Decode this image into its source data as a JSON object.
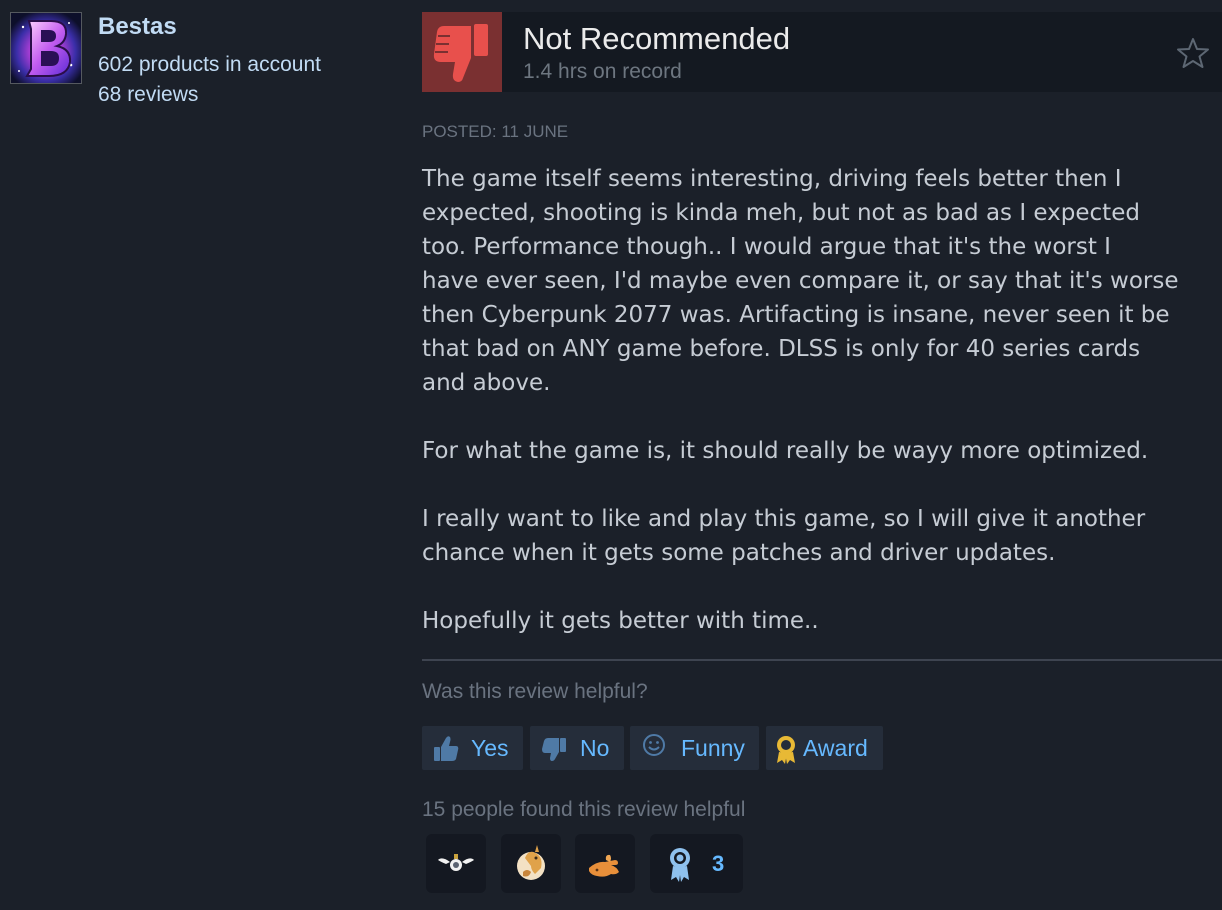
{
  "author": {
    "name": "Bestas",
    "products": "602 products in account",
    "reviews": "68 reviews",
    "avatar_icon": "letter-b-nebula-avatar"
  },
  "review": {
    "verdict": "Not Recommended",
    "hours": "1.4 hrs on record",
    "verdict_icon": "thumbs-down-icon",
    "verdict_color": "#7a3031",
    "posted": "POSTED: 11 JUNE",
    "paragraphs": [
      [
        "The game itself seems interesting, driving feels better then I",
        "expected, shooting is kinda meh, but not as bad as I expected",
        "too. Performance though.. I would argue that it's the worst I",
        "have ever seen, I'd maybe even compare it, or say that it's worse",
        "then Cyberpunk 2077 was. Artifacting is insane, never seen it be",
        "that bad on ANY game before. DLSS is only for 40 series cards",
        "and above."
      ],
      [
        "For what the game is, it should really be wayy more optimized."
      ],
      [
        "I really want to like and play this game, so I will give it another",
        "chance when it gets some patches and driver updates."
      ],
      [
        "Hopefully it gets better with time.."
      ]
    ]
  },
  "feedback": {
    "question": "Was this review helpful?",
    "buttons": {
      "yes": "Yes",
      "no": "No",
      "funny": "Funny",
      "award": "Award"
    },
    "helpful_count_text": "15 people found this review helpful",
    "accent_color": "#66b9ff"
  },
  "awards": [
    {
      "icon": "winged-coin-award-icon"
    },
    {
      "icon": "llama-award-icon"
    },
    {
      "icon": "pointing-hand-award-icon"
    },
    {
      "icon": "ribbon-award-icon",
      "count": "3"
    }
  ]
}
